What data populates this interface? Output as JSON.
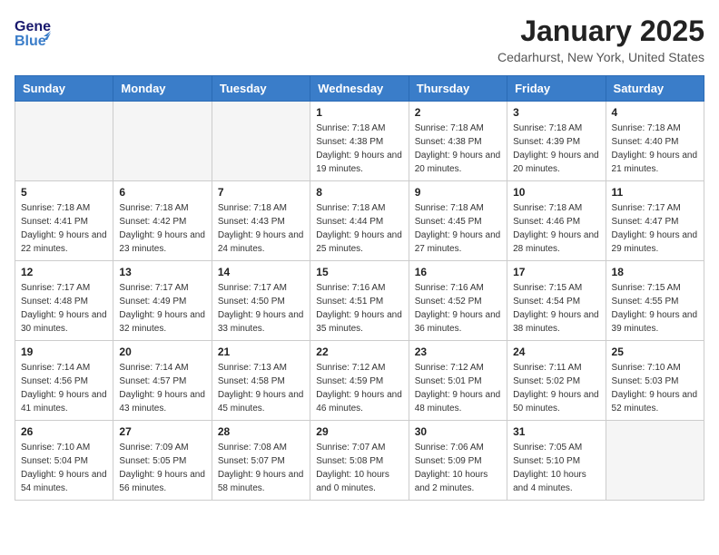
{
  "header": {
    "logo_general": "General",
    "logo_blue": "Blue",
    "month": "January 2025",
    "location": "Cedarhurst, New York, United States"
  },
  "weekdays": [
    "Sunday",
    "Monday",
    "Tuesday",
    "Wednesday",
    "Thursday",
    "Friday",
    "Saturday"
  ],
  "weeks": [
    [
      {
        "day": "",
        "sunrise": "",
        "sunset": "",
        "daylight": ""
      },
      {
        "day": "",
        "sunrise": "",
        "sunset": "",
        "daylight": ""
      },
      {
        "day": "",
        "sunrise": "",
        "sunset": "",
        "daylight": ""
      },
      {
        "day": "1",
        "sunrise": "Sunrise: 7:18 AM",
        "sunset": "Sunset: 4:38 PM",
        "daylight": "Daylight: 9 hours and 19 minutes."
      },
      {
        "day": "2",
        "sunrise": "Sunrise: 7:18 AM",
        "sunset": "Sunset: 4:38 PM",
        "daylight": "Daylight: 9 hours and 20 minutes."
      },
      {
        "day": "3",
        "sunrise": "Sunrise: 7:18 AM",
        "sunset": "Sunset: 4:39 PM",
        "daylight": "Daylight: 9 hours and 20 minutes."
      },
      {
        "day": "4",
        "sunrise": "Sunrise: 7:18 AM",
        "sunset": "Sunset: 4:40 PM",
        "daylight": "Daylight: 9 hours and 21 minutes."
      }
    ],
    [
      {
        "day": "5",
        "sunrise": "Sunrise: 7:18 AM",
        "sunset": "Sunset: 4:41 PM",
        "daylight": "Daylight: 9 hours and 22 minutes."
      },
      {
        "day": "6",
        "sunrise": "Sunrise: 7:18 AM",
        "sunset": "Sunset: 4:42 PM",
        "daylight": "Daylight: 9 hours and 23 minutes."
      },
      {
        "day": "7",
        "sunrise": "Sunrise: 7:18 AM",
        "sunset": "Sunset: 4:43 PM",
        "daylight": "Daylight: 9 hours and 24 minutes."
      },
      {
        "day": "8",
        "sunrise": "Sunrise: 7:18 AM",
        "sunset": "Sunset: 4:44 PM",
        "daylight": "Daylight: 9 hours and 25 minutes."
      },
      {
        "day": "9",
        "sunrise": "Sunrise: 7:18 AM",
        "sunset": "Sunset: 4:45 PM",
        "daylight": "Daylight: 9 hours and 27 minutes."
      },
      {
        "day": "10",
        "sunrise": "Sunrise: 7:18 AM",
        "sunset": "Sunset: 4:46 PM",
        "daylight": "Daylight: 9 hours and 28 minutes."
      },
      {
        "day": "11",
        "sunrise": "Sunrise: 7:17 AM",
        "sunset": "Sunset: 4:47 PM",
        "daylight": "Daylight: 9 hours and 29 minutes."
      }
    ],
    [
      {
        "day": "12",
        "sunrise": "Sunrise: 7:17 AM",
        "sunset": "Sunset: 4:48 PM",
        "daylight": "Daylight: 9 hours and 30 minutes."
      },
      {
        "day": "13",
        "sunrise": "Sunrise: 7:17 AM",
        "sunset": "Sunset: 4:49 PM",
        "daylight": "Daylight: 9 hours and 32 minutes."
      },
      {
        "day": "14",
        "sunrise": "Sunrise: 7:17 AM",
        "sunset": "Sunset: 4:50 PM",
        "daylight": "Daylight: 9 hours and 33 minutes."
      },
      {
        "day": "15",
        "sunrise": "Sunrise: 7:16 AM",
        "sunset": "Sunset: 4:51 PM",
        "daylight": "Daylight: 9 hours and 35 minutes."
      },
      {
        "day": "16",
        "sunrise": "Sunrise: 7:16 AM",
        "sunset": "Sunset: 4:52 PM",
        "daylight": "Daylight: 9 hours and 36 minutes."
      },
      {
        "day": "17",
        "sunrise": "Sunrise: 7:15 AM",
        "sunset": "Sunset: 4:54 PM",
        "daylight": "Daylight: 9 hours and 38 minutes."
      },
      {
        "day": "18",
        "sunrise": "Sunrise: 7:15 AM",
        "sunset": "Sunset: 4:55 PM",
        "daylight": "Daylight: 9 hours and 39 minutes."
      }
    ],
    [
      {
        "day": "19",
        "sunrise": "Sunrise: 7:14 AM",
        "sunset": "Sunset: 4:56 PM",
        "daylight": "Daylight: 9 hours and 41 minutes."
      },
      {
        "day": "20",
        "sunrise": "Sunrise: 7:14 AM",
        "sunset": "Sunset: 4:57 PM",
        "daylight": "Daylight: 9 hours and 43 minutes."
      },
      {
        "day": "21",
        "sunrise": "Sunrise: 7:13 AM",
        "sunset": "Sunset: 4:58 PM",
        "daylight": "Daylight: 9 hours and 45 minutes."
      },
      {
        "day": "22",
        "sunrise": "Sunrise: 7:12 AM",
        "sunset": "Sunset: 4:59 PM",
        "daylight": "Daylight: 9 hours and 46 minutes."
      },
      {
        "day": "23",
        "sunrise": "Sunrise: 7:12 AM",
        "sunset": "Sunset: 5:01 PM",
        "daylight": "Daylight: 9 hours and 48 minutes."
      },
      {
        "day": "24",
        "sunrise": "Sunrise: 7:11 AM",
        "sunset": "Sunset: 5:02 PM",
        "daylight": "Daylight: 9 hours and 50 minutes."
      },
      {
        "day": "25",
        "sunrise": "Sunrise: 7:10 AM",
        "sunset": "Sunset: 5:03 PM",
        "daylight": "Daylight: 9 hours and 52 minutes."
      }
    ],
    [
      {
        "day": "26",
        "sunrise": "Sunrise: 7:10 AM",
        "sunset": "Sunset: 5:04 PM",
        "daylight": "Daylight: 9 hours and 54 minutes."
      },
      {
        "day": "27",
        "sunrise": "Sunrise: 7:09 AM",
        "sunset": "Sunset: 5:05 PM",
        "daylight": "Daylight: 9 hours and 56 minutes."
      },
      {
        "day": "28",
        "sunrise": "Sunrise: 7:08 AM",
        "sunset": "Sunset: 5:07 PM",
        "daylight": "Daylight: 9 hours and 58 minutes."
      },
      {
        "day": "29",
        "sunrise": "Sunrise: 7:07 AM",
        "sunset": "Sunset: 5:08 PM",
        "daylight": "Daylight: 10 hours and 0 minutes."
      },
      {
        "day": "30",
        "sunrise": "Sunrise: 7:06 AM",
        "sunset": "Sunset: 5:09 PM",
        "daylight": "Daylight: 10 hours and 2 minutes."
      },
      {
        "day": "31",
        "sunrise": "Sunrise: 7:05 AM",
        "sunset": "Sunset: 5:10 PM",
        "daylight": "Daylight: 10 hours and 4 minutes."
      },
      {
        "day": "",
        "sunrise": "",
        "sunset": "",
        "daylight": ""
      }
    ]
  ]
}
